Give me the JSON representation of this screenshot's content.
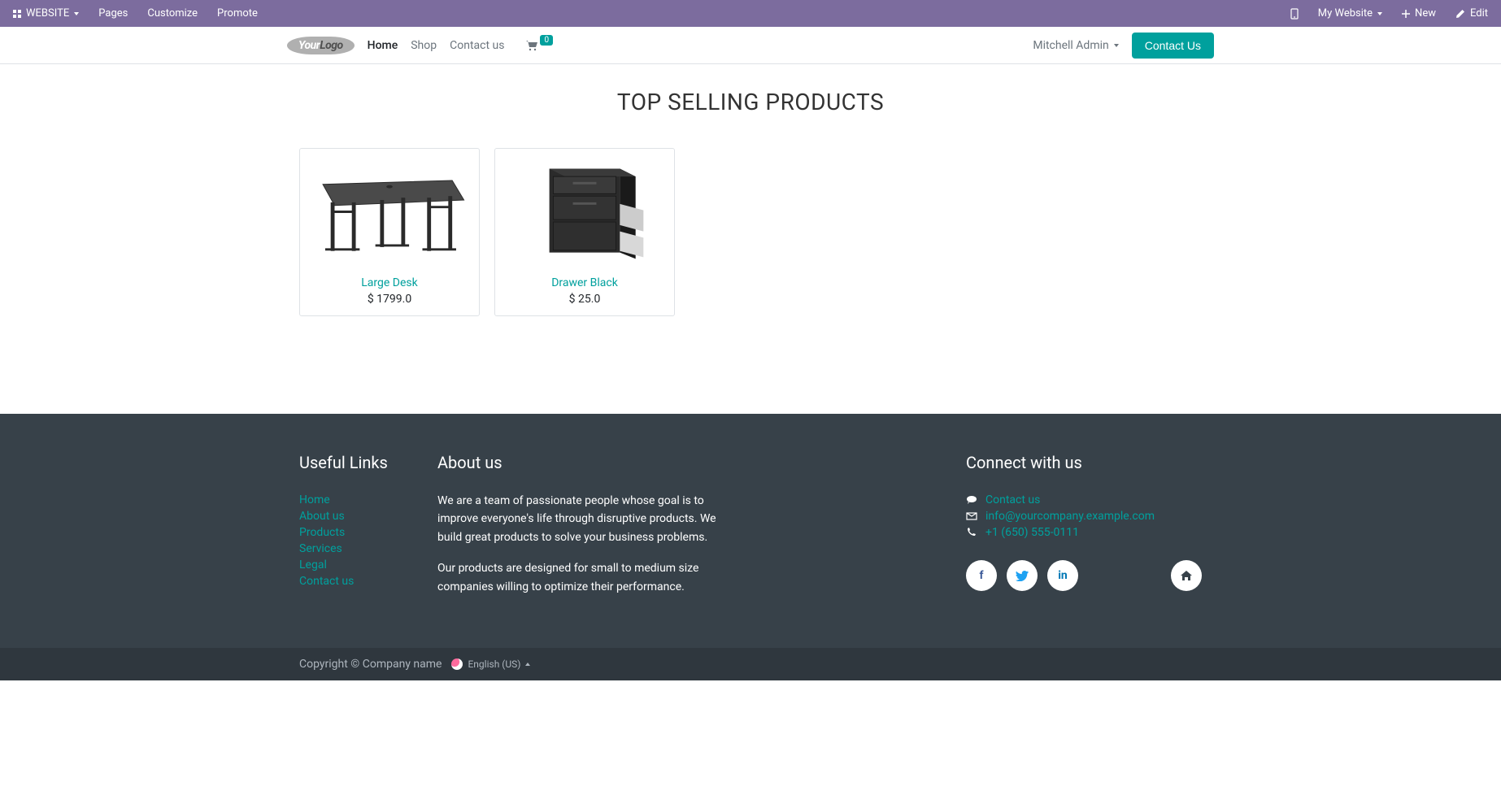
{
  "topToolbar": {
    "website": "WEBSITE",
    "pages": "Pages",
    "customize": "Customize",
    "promote": "Promote",
    "myWebsite": "My Website",
    "new": "New",
    "edit": "Edit"
  },
  "header": {
    "logo": {
      "your": "Your",
      "logo": "Logo"
    },
    "nav": {
      "home": "Home",
      "shop": "Shop",
      "contact": "Contact us"
    },
    "cartCount": "0",
    "user": "Mitchell Admin",
    "contactBtn": "Contact Us"
  },
  "main": {
    "sectionTitle": "TOP SELLING PRODUCTS",
    "products": [
      {
        "name": "Large Desk",
        "price": "$ 1799.0"
      },
      {
        "name": "Drawer Black",
        "price": "$ 25.0"
      }
    ]
  },
  "footer": {
    "usefulLinks": {
      "heading": "Useful Links",
      "items": [
        "Home",
        "About us",
        "Products",
        "Services",
        "Legal",
        "Contact us"
      ]
    },
    "about": {
      "heading": "About us",
      "p1": "We are a team of passionate people whose goal is to improve everyone's life through disruptive products. We build great products to solve your business problems.",
      "p2": "Our products are designed for small to medium size companies willing to optimize their performance."
    },
    "connect": {
      "heading": "Connect with us",
      "contact": "Contact us",
      "email": "info@yourcompany.example.com",
      "phone": "+1 (650) 555-0111"
    },
    "copyright": "Copyright © Company name",
    "language": "English (US)"
  }
}
